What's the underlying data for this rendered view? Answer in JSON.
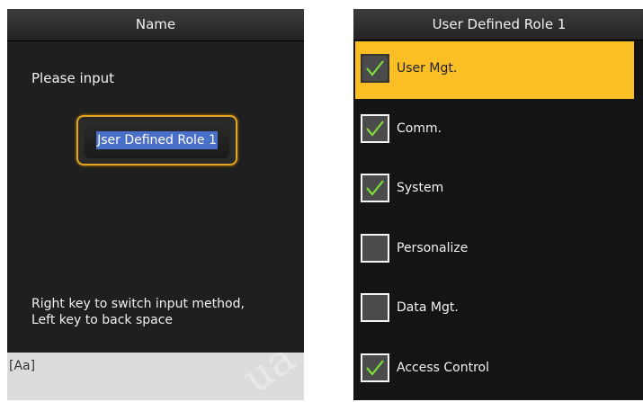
{
  "left_panel": {
    "title": "Name",
    "prompt": "Please input",
    "input_value": "Jser Defined Role 1",
    "hint_line1": "Right key to switch input method,",
    "hint_line2": "Left key to back space",
    "input_mode": "[Aa]",
    "accent_color": "#e5a51c"
  },
  "right_panel": {
    "title": "User Defined Role 1",
    "items": [
      {
        "label": "User Mgt.",
        "checked": true,
        "selected": true
      },
      {
        "label": "Comm.",
        "checked": true,
        "selected": false
      },
      {
        "label": "System",
        "checked": true,
        "selected": false
      },
      {
        "label": "Personalize",
        "checked": false,
        "selected": false
      },
      {
        "label": "Data Mgt.",
        "checked": false,
        "selected": false
      },
      {
        "label": "Access Control",
        "checked": true,
        "selected": false
      }
    ],
    "highlight_color": "#fbbf26",
    "check_color": "#7ddb3a"
  },
  "watermark_text": "ua"
}
